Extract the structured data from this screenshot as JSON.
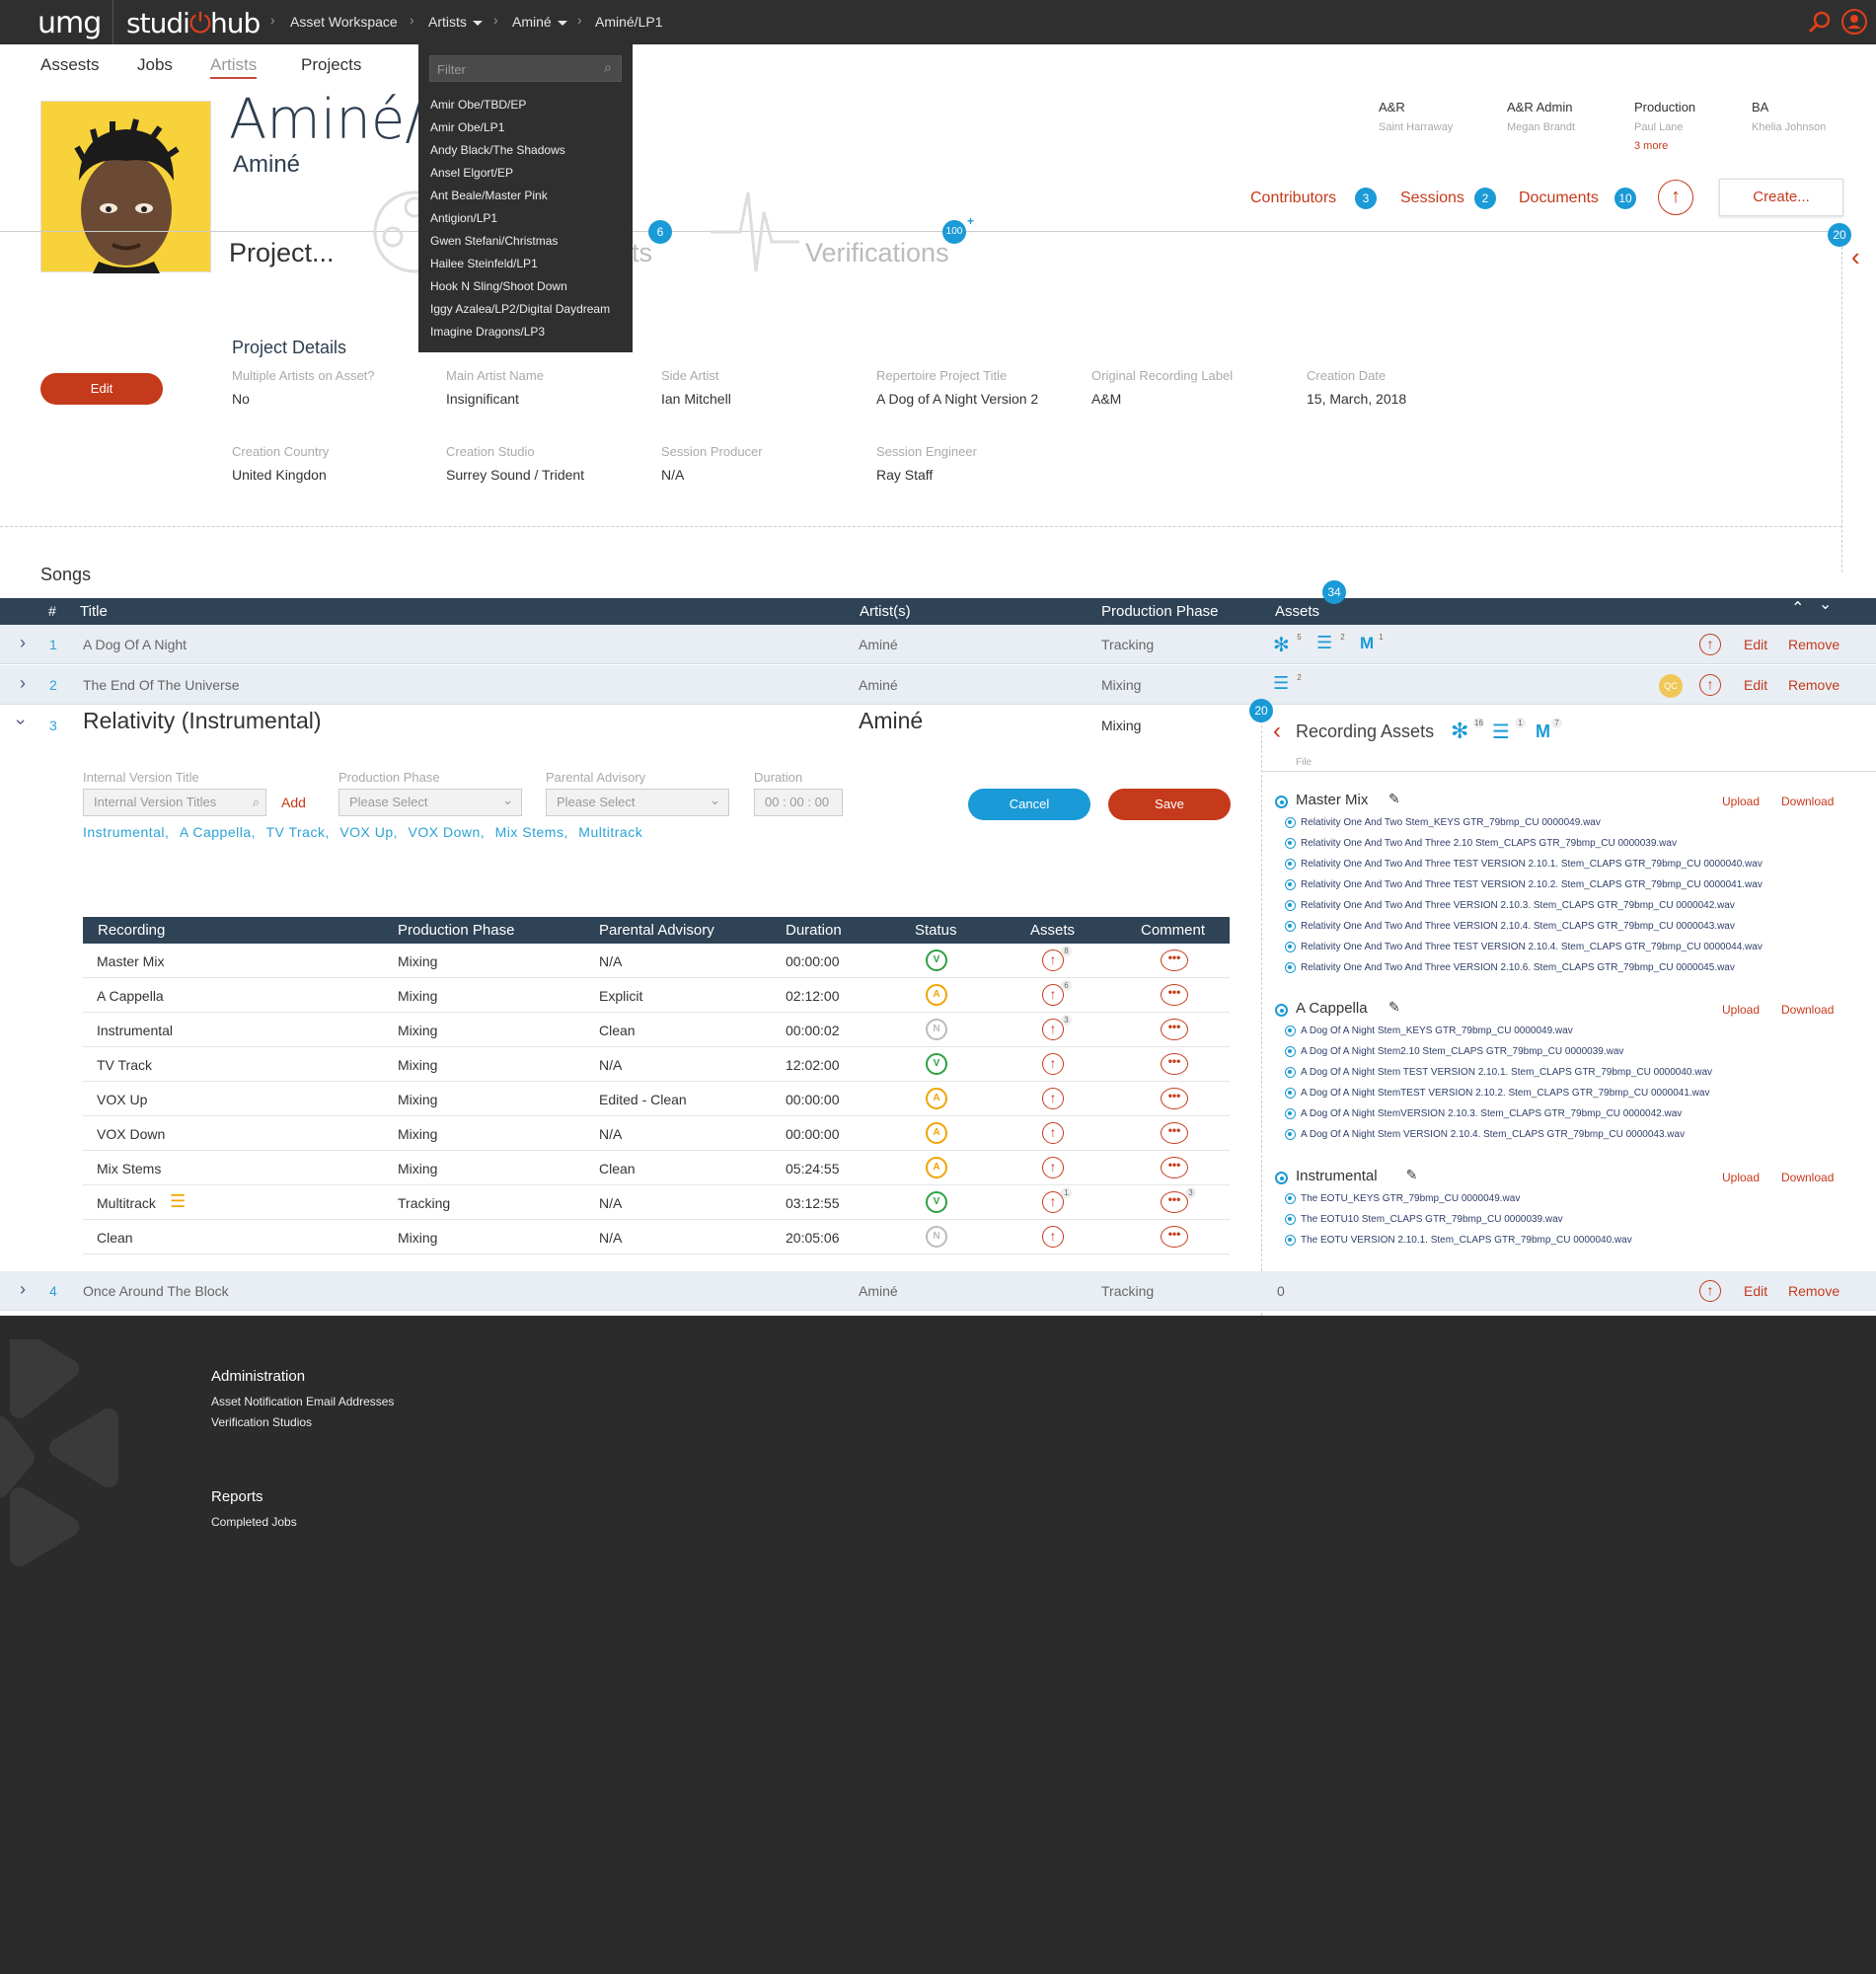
{
  "topbar": {
    "logo_umg": "umg",
    "logo_studio_a": "studi",
    "logo_studio_b": "hub",
    "crumbs": [
      "Asset Workspace",
      "Artists",
      "Aminé",
      "Aminé/LP1"
    ]
  },
  "nav": {
    "tabs": [
      "Assests",
      "Jobs",
      "Artists",
      "Projects"
    ]
  },
  "artist_dropdown": {
    "filter_placeholder": "Filter",
    "items": [
      "Amir Obe/TBD/EP",
      "Amir Obe/LP1",
      "Andy Black/The Shadows",
      "Ansel Elgort/EP",
      "Ant Beale/Master Pink",
      "Antigion/LP1",
      "Gwen Stefani/Christmas",
      "Hailee Steinfeld/LP1",
      "Hook N Sling/Shoot Down",
      "Iggy Azalea/LP2/Digital Daydream",
      "Imagine Dragons/LP3"
    ]
  },
  "header": {
    "title": "Aminé/L",
    "subtitle": "Aminé",
    "project_label": "Project...",
    "assets_label_fragment": "ts",
    "verifications_label": "Verifications",
    "badge_assets": "6",
    "badge_verifications": "100",
    "badge_verifications_plus": "+",
    "badge_right": "20"
  },
  "roles": [
    {
      "role": "A&R",
      "name": "Saint Harraway"
    },
    {
      "role": "A&R Admin",
      "name": "Megan Brandt"
    },
    {
      "role": "Production",
      "name": "Paul Lane",
      "more": "3 more"
    },
    {
      "role": "BA",
      "name": "Khelia Johnson"
    }
  ],
  "actions": {
    "contributors": "Contributors",
    "contributors_count": "3",
    "sessions": "Sessions",
    "sessions_count": "2",
    "documents": "Documents",
    "documents_count": "10",
    "create": "Create..."
  },
  "project_details": {
    "heading": "Project Details",
    "edit": "Edit",
    "fields": [
      {
        "label": "Multiple Artists on Asset?",
        "value": "No"
      },
      {
        "label": "Main Artist Name",
        "value": "Insignificant"
      },
      {
        "label": "Side Artist",
        "value": "Ian Mitchell"
      },
      {
        "label": "Repertoire Project Title",
        "value": "A Dog of A Night Version 2"
      },
      {
        "label": "Original Recording Label",
        "value": "A&M"
      },
      {
        "label": "Creation Date",
        "value": "15, March, 2018"
      },
      {
        "label": "Creation Country",
        "value": "United Kingdon"
      },
      {
        "label": "Creation Studio",
        "value": "Surrey Sound / Trident"
      },
      {
        "label": "Session Producer",
        "value": "N/A"
      },
      {
        "label": "Session Engineer",
        "value": "Ray Staff"
      }
    ]
  },
  "songs": {
    "heading": "Songs",
    "assets_badge": "34",
    "columns": [
      "#",
      "Title",
      "Artist(s)",
      "Production Phase",
      "Assets"
    ],
    "rows": [
      {
        "num": "1",
        "title": "A Dog Of A Night",
        "artist": "Aminé",
        "phase": "Tracking",
        "a1": "5",
        "a2": "2",
        "a3": "1",
        "edit": "Edit",
        "remove": "Remove"
      },
      {
        "num": "2",
        "title": "The End Of The Universe",
        "artist": "Aminé",
        "phase": "Mixing",
        "a2": "2",
        "qc": "QC",
        "edit": "Edit",
        "remove": "Remove"
      },
      {
        "num": "3",
        "title": "Relativity (Instrumental)",
        "artist": "Aminé",
        "phase": "Mixing"
      },
      {
        "num": "4",
        "title": "Once Around The Block",
        "artist": "Aminé",
        "phase": "Tracking",
        "assets": "0",
        "edit": "Edit",
        "remove": "Remove"
      }
    ]
  },
  "expanded": {
    "labels": {
      "ivt": "Internal Version Title",
      "pp": "Production Phase",
      "pa": "Parental Advisory",
      "dur": "Duration"
    },
    "ivt_placeholder": "Internal Version Titles",
    "add": "Add",
    "please_select": "Please Select",
    "duration_placeholder": "00 : 00 : 00",
    "cancel": "Cancel",
    "save": "Save",
    "tags": [
      "Instrumental,",
      "A Cappella,",
      "TV Track,",
      "VOX Up,",
      "VOX Down,",
      "Mix Stems,",
      "Multitrack"
    ],
    "rec_columns": [
      "Recording",
      "Production Phase",
      "Parental Advisory",
      "Duration",
      "Status",
      "Assets",
      "Comment"
    ],
    "recordings": [
      {
        "name": "Master Mix",
        "phase": "Mixing",
        "advisory": "N/A",
        "duration": "00:00:00",
        "status": "V",
        "assets_count": "8"
      },
      {
        "name": "A Cappella",
        "phase": "Mixing",
        "advisory": "Explicit",
        "duration": "02:12:00",
        "status": "A",
        "assets_count": "6"
      },
      {
        "name": "Instrumental",
        "phase": "Mixing",
        "advisory": "Clean",
        "duration": "00:00:02",
        "status": "N",
        "assets_count": "3"
      },
      {
        "name": "TV Track",
        "phase": "Mixing",
        "advisory": "N/A",
        "duration": "12:02:00",
        "status": "V"
      },
      {
        "name": "VOX Up",
        "phase": "Mixing",
        "advisory": "Edited - Clean",
        "duration": "00:00:00",
        "status": "A"
      },
      {
        "name": "VOX Down",
        "phase": "Mixing",
        "advisory": "N/A",
        "duration": "00:00:00",
        "status": "A"
      },
      {
        "name": "Mix Stems",
        "phase": "Mixing",
        "advisory": "Clean",
        "duration": "05:24:55",
        "status": "A"
      },
      {
        "name": "Multitrack",
        "phase": "Tracking",
        "advisory": "N/A",
        "duration": "03:12:55",
        "status": "V",
        "assets_count": "1",
        "comment_count": "3"
      },
      {
        "name": "Clean",
        "phase": "Mixing",
        "advisory": "N/A",
        "duration": "20:05:06",
        "status": "N"
      }
    ]
  },
  "recording_assets": {
    "badge": "20",
    "title": "Recording Assets",
    "counts": [
      "16",
      "1",
      "7"
    ],
    "file_label": "File",
    "upload": "Upload",
    "download": "Download",
    "groups": [
      {
        "name": "Master Mix",
        "files": [
          "Relativity One And Two Stem_KEYS GTR_79bmp_CU 0000049.wav",
          "Relativity One And Two And Three 2.10 Stem_CLAPS GTR_79bmp_CU 0000039.wav",
          "Relativity One And Two And Three TEST VERSION 2.10.1. Stem_CLAPS GTR_79bmp_CU 0000040.wav",
          "Relativity One And Two And Three TEST VERSION 2.10.2. Stem_CLAPS GTR_79bmp_CU 0000041.wav",
          "Relativity One And Two And Three VERSION 2.10.3. Stem_CLAPS GTR_79bmp_CU 0000042.wav",
          "Relativity One And Two And Three VERSION 2.10.4. Stem_CLAPS GTR_79bmp_CU 0000043.wav",
          "Relativity One And Two And Three TEST VERSION 2.10.4. Stem_CLAPS GTR_79bmp_CU 0000044.wav",
          "Relativity One And Two And Three VERSION 2.10.6. Stem_CLAPS GTR_79bmp_CU 0000045.wav"
        ]
      },
      {
        "name": "A Cappella",
        "files": [
          "A Dog Of A Night Stem_KEYS GTR_79bmp_CU 0000049.wav",
          "A Dog Of A Night Stem2.10 Stem_CLAPS GTR_79bmp_CU 0000039.wav",
          "A Dog Of A Night Stem TEST VERSION 2.10.1. Stem_CLAPS GTR_79bmp_CU 0000040.wav",
          "A Dog Of A Night StemTEST VERSION 2.10.2. Stem_CLAPS GTR_79bmp_CU 0000041.wav",
          "A Dog Of A Night StemVERSION 2.10.3. Stem_CLAPS GTR_79bmp_CU 0000042.wav",
          "A Dog Of A Night Stem VERSION 2.10.4. Stem_CLAPS GTR_79bmp_CU 0000043.wav"
        ]
      },
      {
        "name": "Instrumental",
        "files": [
          "The EOTU_KEYS GTR_79bmp_CU 0000049.wav",
          "The EOTU10 Stem_CLAPS GTR_79bmp_CU 0000039.wav",
          "The EOTU VERSION 2.10.1. Stem_CLAPS GTR_79bmp_CU 0000040.wav"
        ]
      }
    ]
  },
  "footer": {
    "admin_heading": "Administration",
    "admin_links": [
      "Asset Notification Email Addresses",
      "Verification Studios"
    ],
    "reports_heading": "Reports",
    "reports_links": [
      "Completed Jobs"
    ]
  },
  "colors": {
    "accent": "#c53a1b",
    "badge": "#1a9ad6",
    "header_dark": "#2f4356",
    "topbar": "#2f2f30"
  }
}
